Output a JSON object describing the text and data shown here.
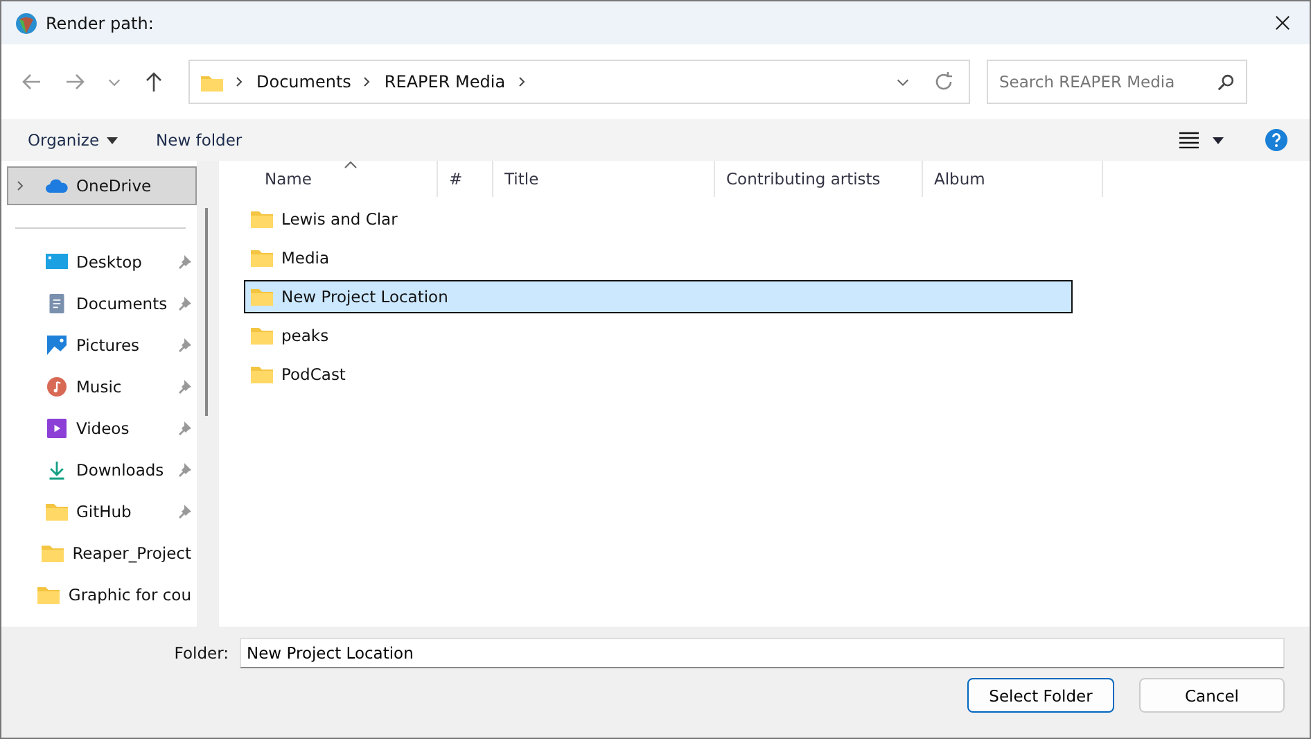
{
  "window": {
    "title": "Render path:"
  },
  "address_bar": {
    "crumbs": [
      "Documents",
      "REAPER Media"
    ]
  },
  "search": {
    "placeholder": "Search REAPER Media"
  },
  "toolbar": {
    "organize": "Organize",
    "new_folder": "New folder"
  },
  "sidebar": {
    "items": [
      {
        "label": "OneDrive",
        "kind": "onedrive",
        "selected": true,
        "pinned": false,
        "expandable": true
      },
      {
        "label": "Desktop",
        "kind": "desktop",
        "selected": false,
        "pinned": true,
        "expandable": false
      },
      {
        "label": "Documents",
        "kind": "documents",
        "selected": false,
        "pinned": true,
        "expandable": false
      },
      {
        "label": "Pictures",
        "kind": "pictures",
        "selected": false,
        "pinned": true,
        "expandable": false
      },
      {
        "label": "Music",
        "kind": "music",
        "selected": false,
        "pinned": true,
        "expandable": false
      },
      {
        "label": "Videos",
        "kind": "videos",
        "selected": false,
        "pinned": true,
        "expandable": false
      },
      {
        "label": "Downloads",
        "kind": "downloads",
        "selected": false,
        "pinned": true,
        "expandable": false
      },
      {
        "label": "GitHub",
        "kind": "folder",
        "selected": false,
        "pinned": true,
        "expandable": false
      },
      {
        "label": "Reaper_Project",
        "kind": "folder",
        "selected": false,
        "pinned": false,
        "expandable": false
      },
      {
        "label": "Graphic for cou",
        "kind": "folder",
        "selected": false,
        "pinned": false,
        "expandable": false
      }
    ]
  },
  "table": {
    "columns": [
      "Name",
      "#",
      "Title",
      "Contributing artists",
      "Album"
    ],
    "rows": [
      {
        "name": "Lewis and Clar",
        "selected": false
      },
      {
        "name": "Media",
        "selected": false
      },
      {
        "name": "New Project Location",
        "selected": true
      },
      {
        "name": "peaks",
        "selected": false
      },
      {
        "name": "PodCast",
        "selected": false
      }
    ]
  },
  "footer": {
    "folder_label": "Folder:",
    "folder_value": "New Project Location",
    "buttons": [
      "Select Folder",
      "Cancel"
    ]
  }
}
